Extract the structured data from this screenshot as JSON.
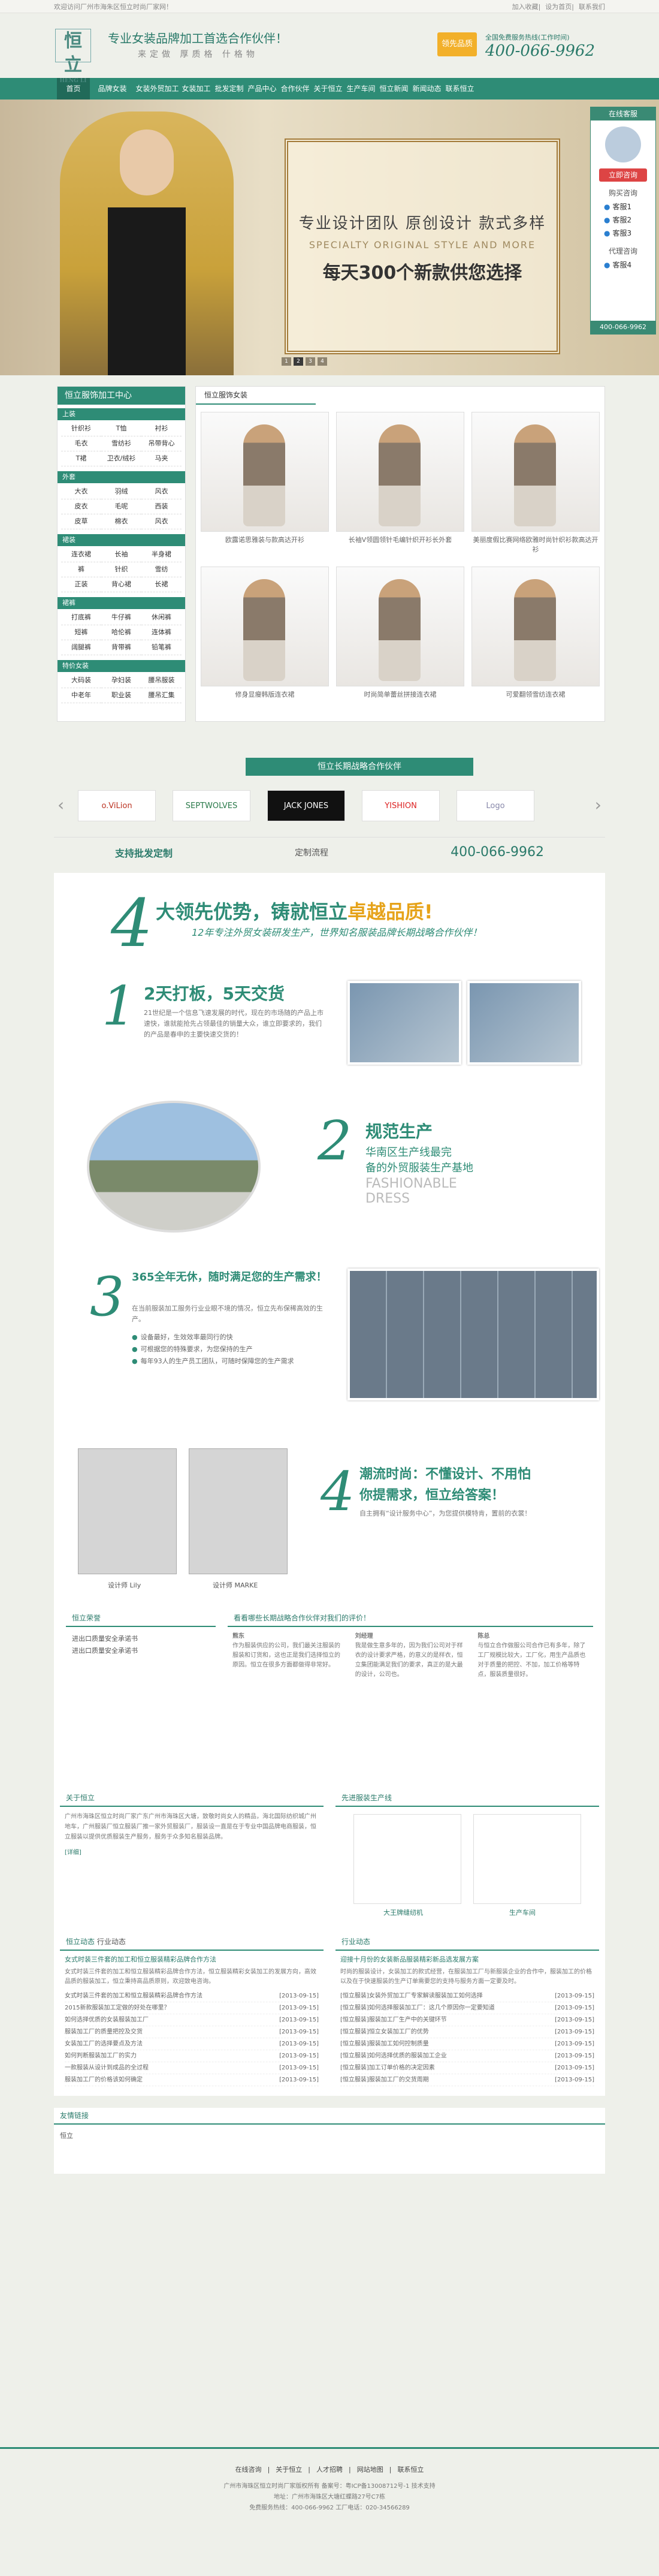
{
  "topbar": {
    "welcome": "欢迎访问厂州市海朱区恒立时尚厂家网！",
    "links": [
      "加入收藏",
      "设为首页",
      "联系我们"
    ]
  },
  "header": {
    "logo": "恒立",
    "logo_en": "HENG LI",
    "slogan": "专业女装品牌加工首选合作伙伴！",
    "slogan_sub": "来定做  厚质格  什格物",
    "badge": "领先品质",
    "phone_label": "全国免费服务热线(工作时间)",
    "phone": "400-066-9962"
  },
  "nav": [
    "首页",
    "品牌女装OEM",
    "女装外贸加工",
    "女装加工",
    "批发定制",
    "产品中心",
    "合作伙伴",
    "关于恒立",
    "生产车间",
    "恒立新闻",
    "新闻动态",
    "联系恒立"
  ],
  "banner": {
    "t1": "专业设计团队  原创设计  款式多样",
    "t2": "SPECIALTY ORIGINAL STYLE AND MORE",
    "t3": "每天300个新款供您选择",
    "dots": [
      "1",
      "2",
      "3",
      "4"
    ]
  },
  "kefu": {
    "title": "在线客服",
    "consult": "立即咨询",
    "sec1": "购买咨询",
    "qq1": [
      "客服1",
      "客服2",
      "客服3"
    ],
    "sec2": "代理咨询",
    "qq2": [
      "客服4"
    ],
    "phone": "400-066-9962"
  },
  "sidebar": {
    "title": "恒立服饰加工中心",
    "cats": [
      {
        "name": "上装",
        "items": [
          "针织衫",
          "T恤",
          "衬衫",
          "毛衣",
          "雪纺衫",
          "吊带背心",
          "T裙",
          "卫衣/绒衫",
          "马夹"
        ]
      },
      {
        "name": "外套",
        "items": [
          "大衣",
          "羽绒",
          "风衣",
          "皮衣",
          "毛呢",
          "西装",
          "皮草",
          "棉衣",
          "风衣"
        ]
      },
      {
        "name": "裙装",
        "items": [
          "连衣裙",
          "长袖",
          "半身裙",
          "裤",
          "针织",
          "雪纺",
          "正装",
          "背心裙",
          "长裙"
        ]
      },
      {
        "name": "裙裤",
        "items": [
          "打底裤",
          "牛仔裤",
          "休闲裤",
          "短裤",
          "哈伦裤",
          "连体裤",
          "阔腿裤",
          "背带裤",
          "铅笔裤"
        ]
      },
      {
        "name": "特价女装",
        "items": [
          "大码装",
          "孕妇装",
          "腰吊服装",
          "中老年",
          "职业装",
          "腰吊汇集"
        ]
      }
    ]
  },
  "products": {
    "title": "恒立服饰女装",
    "items": [
      "欧露诺思雅装与款高达开衫",
      "长袖V领圆领针毛编针织开衫长外套",
      "美丽度假比赛网络欧雅时尚针织衫款高达开衫",
      "修身显瘦韩版连衣裙",
      "时尚简单蕾丝拼接连衣裙",
      "可爱翻领雪纺连衣裙"
    ]
  },
  "partner": {
    "title": "恒立长期战略合作伙伴",
    "logos": [
      "o.ViLion",
      "SEPTWOLVES",
      "JACK JONES",
      "YISHION",
      "Logo"
    ],
    "info1": "支持批发定制",
    "info2": "定制流程",
    "info3": "400-066-9962"
  },
  "adv": {
    "num": "4",
    "h1a": "大领先优势，铸就恒立",
    "h1b": "卓越品质!",
    "h2": "12年专注外贸女装研发生产，世界知名服装品牌长期战略合作伙伴！",
    "s1t": "2天打板，5天交货",
    "s1d": "21世纪是一个信息飞速发展的时代，现在的市场随的产品上市速快，谁就能抢先占领最佳的销量大众，谁立即要求的，我们的产品是春申的主要快速交货的！",
    "s2t": "规范生产",
    "s2a": "华南区生产线最完",
    "s2b": "备的外贸服装生产基地",
    "s2c": "FASHIONABLE DRESS",
    "s3t": "365全年无休，随时满足您的生产需求！",
    "s3d": "在当前服装加工服务行业业眼不境的情况，恒立先布保稀高效的生产。",
    "s3b": [
      "设备最好，生效效率最同行的快",
      "可根据您的特殊要求，为您保持的生产",
      "每年93人的生产员工团队，可随时保障您的生产需求"
    ],
    "s4t": "潮流时尚：不懂设计、不用怕",
    "s4b": "你提需求，恒立给答案！",
    "s4d": "自主拥有“设计服务中心”，为您提供模特肯，置前的衣裳！",
    "designers": [
      "设计师 Lily",
      "设计师 MARKE"
    ]
  },
  "sections": {
    "about": "恒立荣誉",
    "partners": "看看哪些长期战略合作伙伴对我们的评价！",
    "hon1": "进出口质量安全承诺书",
    "hon2": "进出口质量安全承诺书",
    "p1n": "熊东",
    "p1d": "作为服装供应的公司，我们最关注服装的服装和订货和，这也正是我们选择恒立的原因。恒立在很多方面都做得非常好。",
    "p2n": "刘经理",
    "p2d": "我是做生意多年的，因为我们公司对于样衣的设计要求严格，的意义的是样衣，恒立集团能满足我们的要求，真正的是大最的设计，公司也。",
    "p3n": "陈总",
    "p3d": "与恒立合作做服公司合作已有多年，除了工厂规模比较大，工厂化，用生产品质也对于质量的把控、不加，加工价格等特点，服装质量很好。",
    "company": "关于恒立",
    "cdesc": "广州市海珠区恒立时尚厂家广东广州市海珠区大塘，致敬时尚女人的精品，海北国际纺织城广州地车，广州服装厂恒立服装厂推一家外贸服装厂，服装设一直是在于专业中国品牌电商服装，恒立服装以提供优质服装生产服务，服务于众多知名服装品牌。",
    "more": "[详细]",
    "workshop": "先进服装生产线",
    "w1": "大王牌缝纫机",
    "w2": "生产车间",
    "news": "恒立动态",
    "industry": "行业动态",
    "n1t": "女式时装三件套的加工和恒立服装精彩品牌合作方法",
    "n1d": "女式时装三件套的加工和恒立服装精彩品牌合作方法，恒立服装精彩女装加工的发展方向，高效品质的服装加工，恒立秉持高品质原则，欢迎致电咨询。",
    "n1m": "[详细]",
    "news_list": [
      "女式时装三件套的加工和恒立服装精彩品牌合作方法",
      "2015新款服装加工定做的好处在哪里？",
      "如何选择优质的女装服装加工厂",
      "服装加工厂的质量把控及交货",
      "女装加工厂的选择要点及方法",
      "如何判断服装加工厂的实力",
      "一款服装从设计到成品的全过程",
      "服装加工厂的价格该如何确定"
    ],
    "dates": [
      "[2013-09-15]",
      "[2013-09-15]",
      "[2013-09-15]",
      "[2013-09-15]",
      "[2013-09-15]",
      "[2013-09-15]",
      "[2013-09-15]",
      "[2013-09-15]"
    ],
    "industry_title": "迎接十月份的女装新品服装精彩新品选发展方案",
    "industry_desc": "时尚的服装设计，女装加工的款式经营，在服装加工厂与新服装企业的合作中，服装加工的价格以及在于快速服装的生产订单需要您的支持与服务方面一定要及时。",
    "ind_list": [
      "[恒立服装]女装外贸加工厂专家解读服装加工如何选择",
      "[恒立服装]如何选择服装加工厂：这几个原因你一定要知道",
      "[恒立服装]服装加工厂生产中的关键环节",
      "[恒立服装]恒立女装加工厂的优势",
      "[恒立服装]服装加工如何控制质量",
      "[恒立服装]如何选择优质的服装加工企业",
      "[恒立服装]加工订单价格的决定因素",
      "[恒立服装]服装加工厂的交货周期"
    ],
    "links": "友情链接",
    "link1": "恒立"
  },
  "footer": {
    "links": [
      "在线咨询",
      "关于恒立",
      "人才招聘",
      "网站地图",
      "联系恒立"
    ],
    "c1": "广州市海珠区恒立时尚厂家版权所有 备案号：粤ICP备13008712号-1 技术支持",
    "c2": "地址：广州市海珠区大塘红蝶路27号C7栋",
    "c3": "免费服务热线：400-066-9962 工厂电话：020-34566289"
  }
}
